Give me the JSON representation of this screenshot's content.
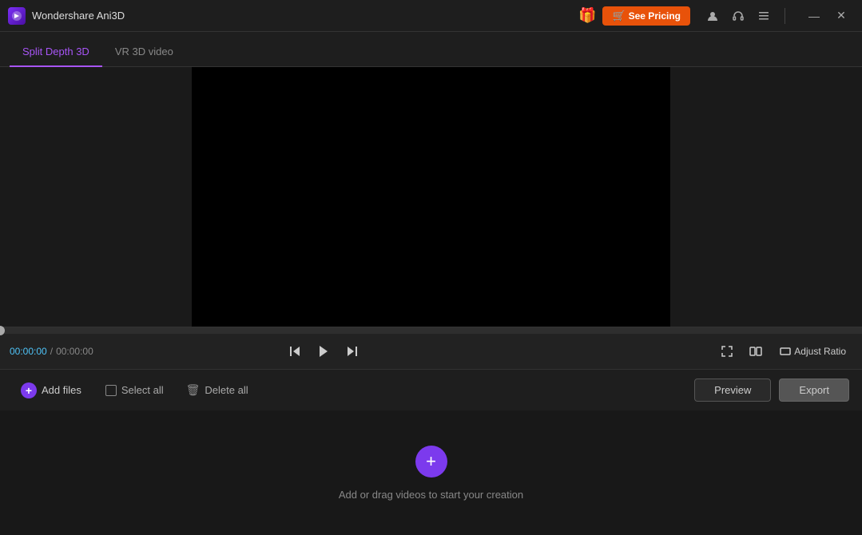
{
  "app": {
    "title": "Wondershare Ani3D",
    "logo_alt": "Ani3D Logo"
  },
  "titlebar": {
    "gift_icon": "🎁",
    "see_pricing_label": "See Pricing",
    "cart_icon": "🛒"
  },
  "window_controls": {
    "minimize": "—",
    "close": "✕"
  },
  "tabs": [
    {
      "id": "split-depth-3d",
      "label": "Split Depth 3D",
      "active": true
    },
    {
      "id": "vr-3d-video",
      "label": "VR 3D video",
      "active": false
    }
  ],
  "playback": {
    "time_current": "00:00:00",
    "time_separator": "/",
    "time_total": "00:00:00",
    "seek_percent": 0
  },
  "controls": {
    "adjust_ratio_label": "Adjust Ratio"
  },
  "toolbar": {
    "add_files_label": "Add files",
    "select_all_label": "Select all",
    "delete_all_label": "Delete all",
    "preview_label": "Preview",
    "export_label": "Export"
  },
  "drop_area": {
    "hint_text": "Add or drag videos to start your creation"
  }
}
